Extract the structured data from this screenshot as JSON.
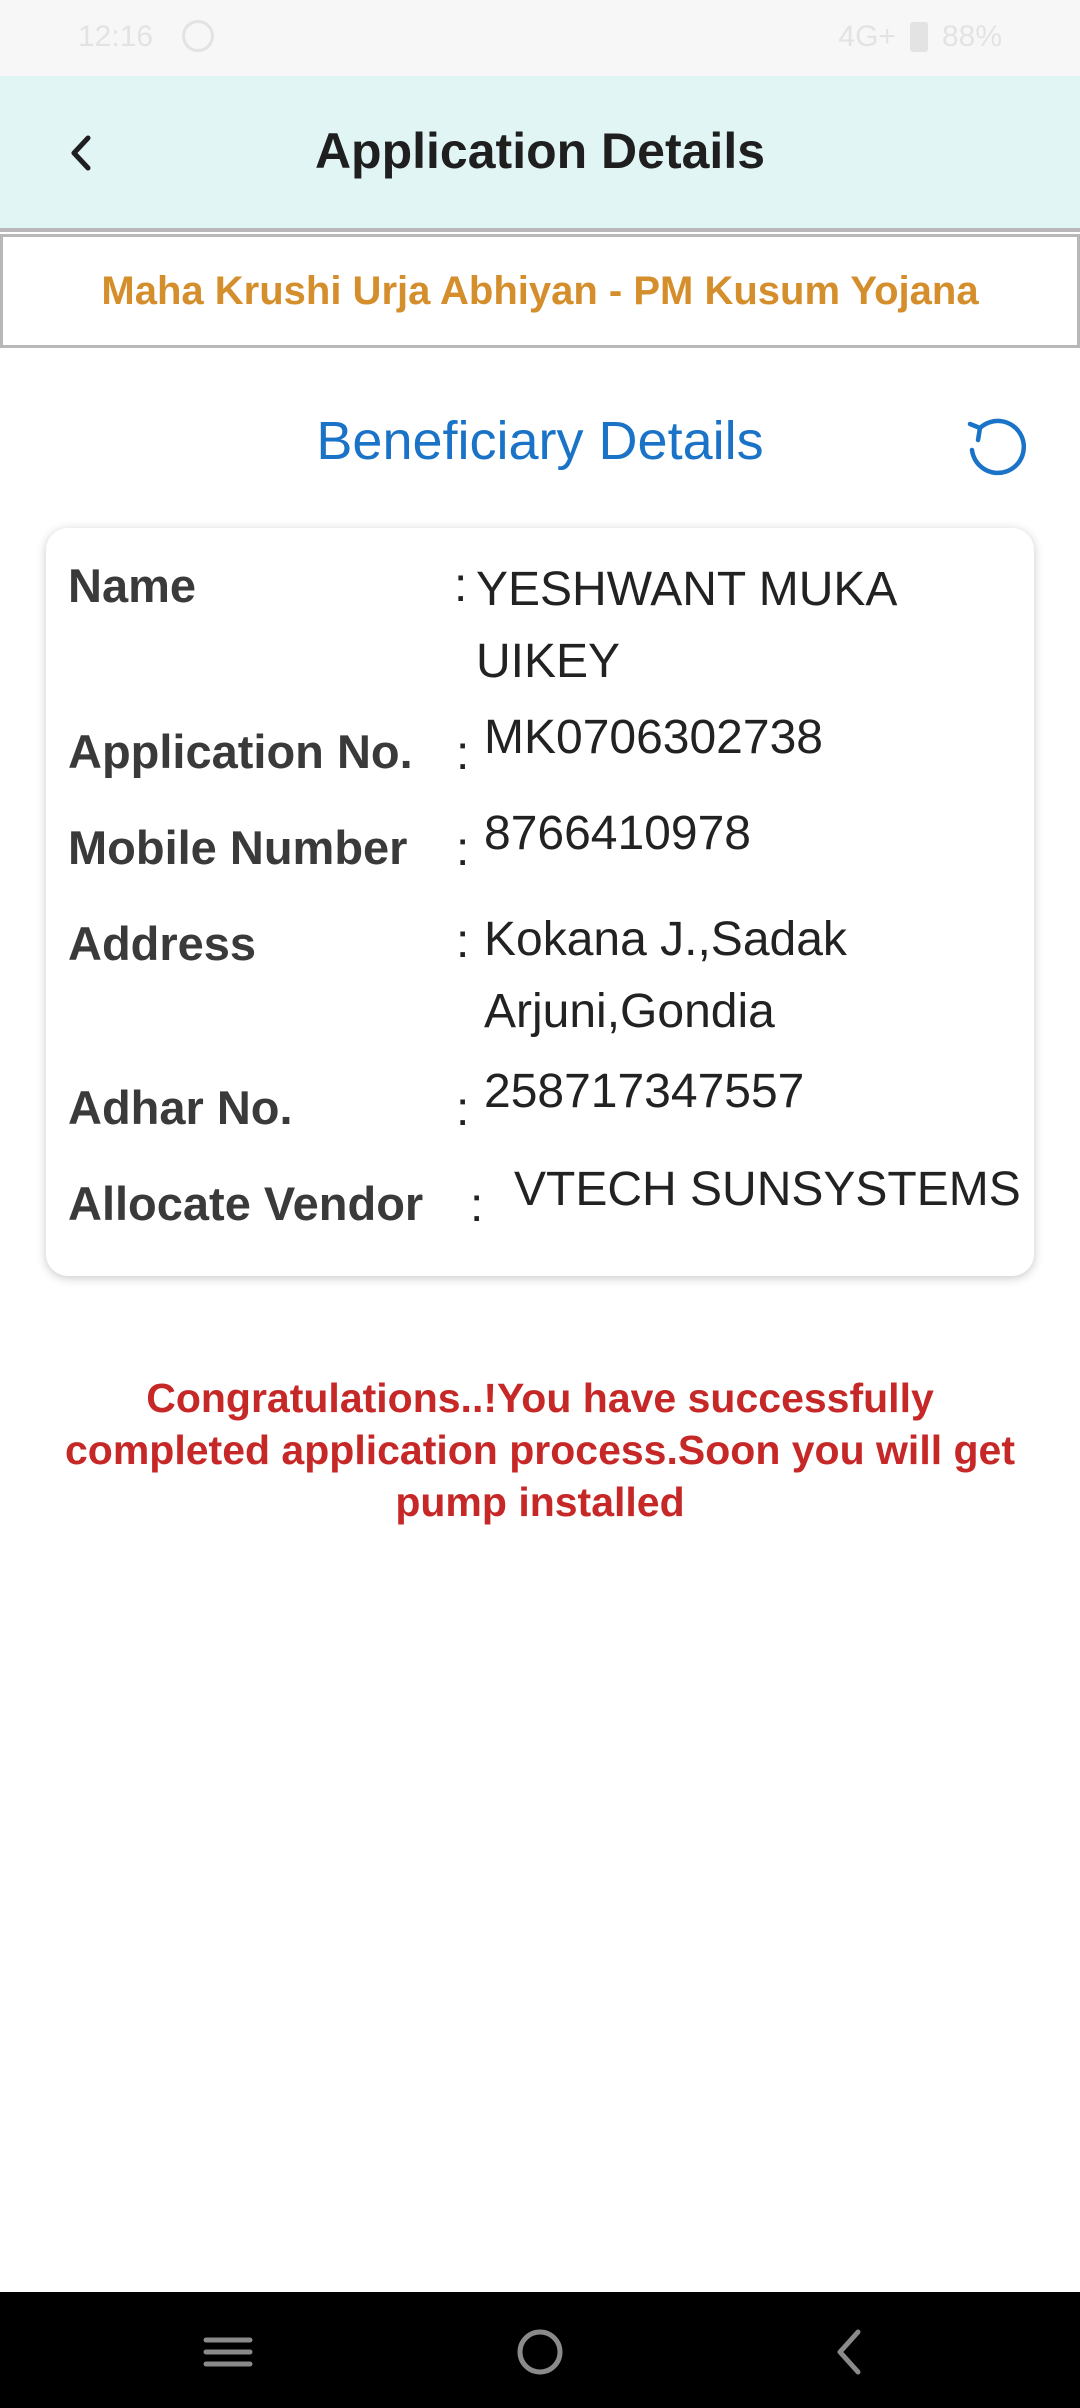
{
  "status_bar": {
    "time": "12:16",
    "network": "4G+",
    "battery": "88%"
  },
  "app_bar": {
    "title": "Application Details"
  },
  "banner": {
    "scheme": "Maha Krushi Urja Abhiyan - PM Kusum Yojana"
  },
  "section": {
    "title": "Beneficiary Details"
  },
  "details": [
    {
      "label": "Name",
      "value": "YESHWANT MUKA UIKEY"
    },
    {
      "label": "Application No.",
      "value": "MK0706302738"
    },
    {
      "label": "Mobile Number",
      "value": "8766410978"
    },
    {
      "label": "Address",
      "value": "Kokana J.,Sadak Arjuni,Gondia"
    },
    {
      "label": "Adhar No.",
      "value": "258717347557"
    },
    {
      "label": "Allocate Vendor",
      "value": "VTECH SUNSYSTEMS"
    }
  ],
  "colon": ":",
  "message": "Congratulations..!You have successfully completed application process.Soon you will get pump installed",
  "colors": {
    "app_bar_bg": "#e1f5f5",
    "banner_text": "#d48e2c",
    "section_title": "#1a73c7",
    "message_text": "#c62828"
  }
}
